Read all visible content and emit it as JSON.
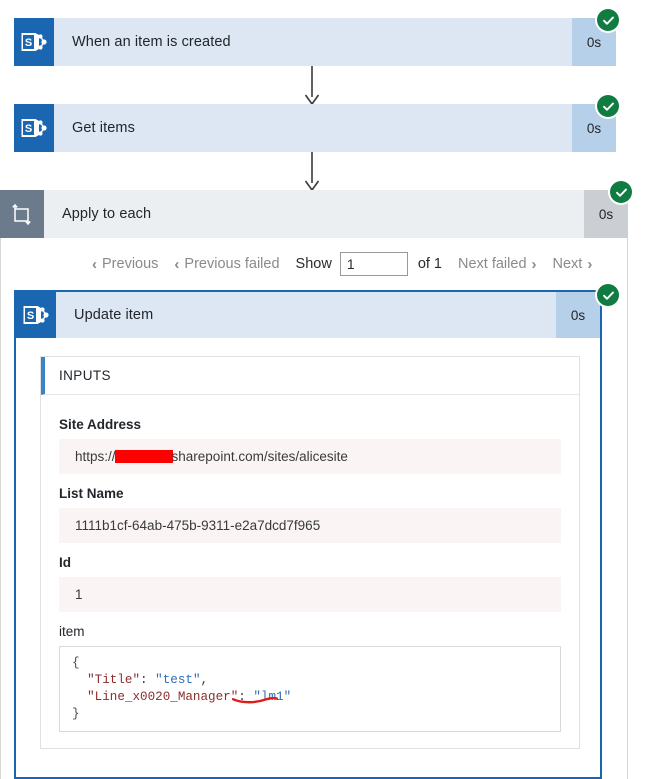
{
  "flow": {
    "nodes": [
      {
        "title": "When an item is created",
        "duration": "0s",
        "icon": "sharepoint-icon",
        "status": "succeeded-icon"
      },
      {
        "title": "Get items",
        "duration": "0s",
        "icon": "sharepoint-icon",
        "status": "succeeded-icon"
      },
      {
        "title": "Apply to each",
        "duration": "0s",
        "icon": "loop-icon",
        "status": "succeeded-icon"
      },
      {
        "title": "Update item",
        "duration": "0s",
        "icon": "sharepoint-icon",
        "status": "succeeded-icon"
      }
    ]
  },
  "pager": {
    "previous_label": "Previous",
    "previous_failed_label": "Previous failed",
    "show_label": "Show",
    "page_value": "1",
    "of_label": "of 1",
    "next_failed_label": "Next failed",
    "next_label": "Next",
    "chevron_left": "‹",
    "chevron_right": "›"
  },
  "inputs": {
    "section_title": "INPUTS",
    "fields": [
      {
        "label": "Site Address",
        "value_prefix": "https://",
        "value_redacted": true,
        "value_suffix": "sharepoint.com/sites/alicesite"
      },
      {
        "label": "List Name",
        "value": "1111b1cf-64ab-475b-9311-e2a7dcd7f965"
      },
      {
        "label": "Id",
        "value": "1"
      }
    ],
    "item_field": {
      "label": "item",
      "json_lines": [
        "{",
        "  \"Title\": \"test\",",
        "  \"Line_x0020_Manager\": \"lm1\"",
        "}"
      ],
      "json_tokens": {
        "open_brace": "{",
        "key_title": "\"Title\"",
        "value_title": "\"test\"",
        "key_manager": "\"Line_x0020_Manager\"",
        "value_manager": "\"lm1\"",
        "close_brace": "}",
        "colon": ": ",
        "comma": ","
      },
      "annotation": "red-underline-on-lm1"
    }
  },
  "colors": {
    "accent_blue": "#1b66b0",
    "card_header_blue": "#dce7f3",
    "card_duration_blue": "#b6d0e9",
    "loop_icon_gray": "#6c7b8c",
    "success_green": "#107c41",
    "value_row_pink": "#faf4f4",
    "redaction_red": "#fe0000",
    "json_key_red": "#8b2d2d",
    "json_value_blue": "#2f6fb5",
    "annotation_red": "#e01b1b"
  }
}
